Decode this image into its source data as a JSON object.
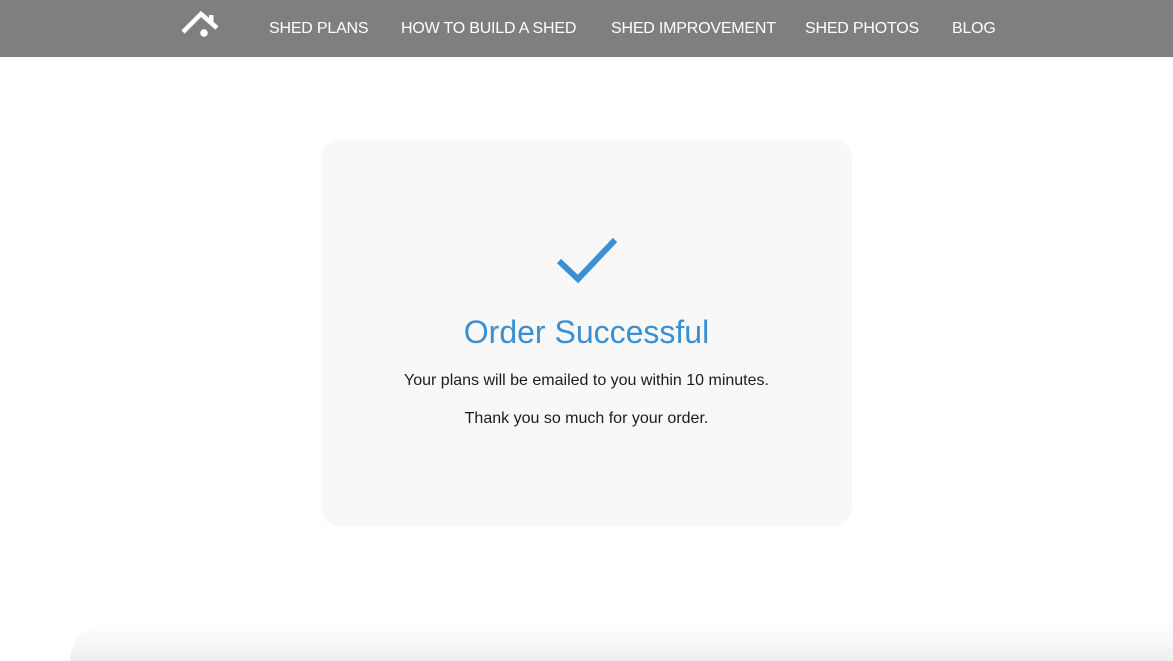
{
  "header": {
    "logo_icon": "house-roof-icon",
    "nav_items": [
      {
        "label": "SHED PLANS"
      },
      {
        "label": "HOW TO BUILD A SHED"
      },
      {
        "label": "SHED IMPROVEMENT"
      },
      {
        "label": "SHED PHOTOS"
      },
      {
        "label": "BLOG"
      }
    ],
    "background_color": "#7f7f7f",
    "text_color": "#ffffff"
  },
  "confirmation": {
    "icon": "checkmark-icon",
    "title": "Order Successful",
    "message": "Your plans will be emailed to you within 10 minutes.",
    "thanks": "Thank you so much for your order.",
    "accent_color": "#3b8fd3",
    "card_color": "#f8f8f8"
  }
}
